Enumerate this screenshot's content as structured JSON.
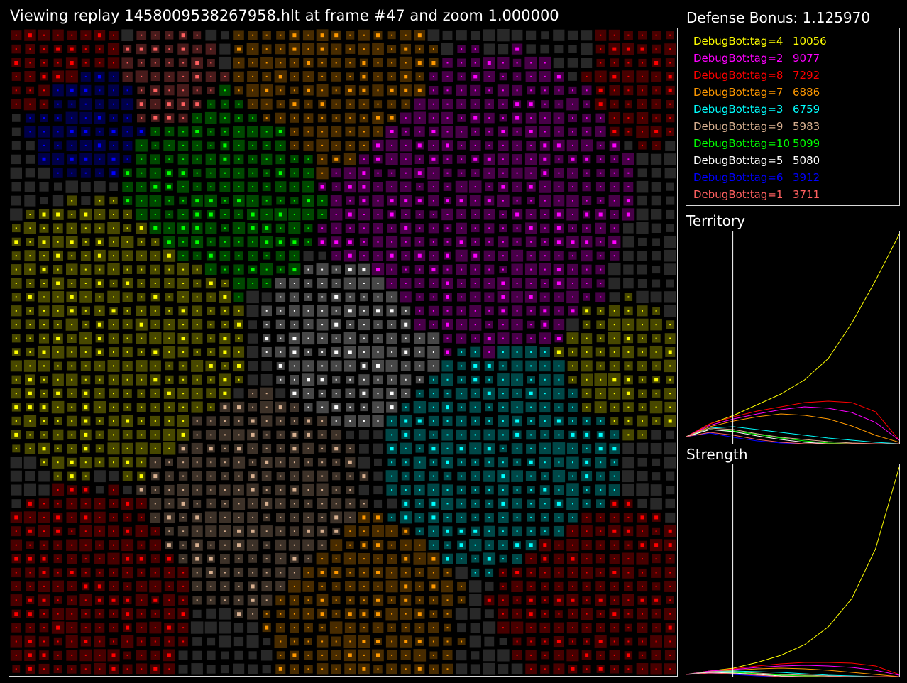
{
  "header": {
    "title": "Viewing replay 1458009538267958.hlt at frame #47 and zoom 1.000000",
    "defense_bonus": "Defense Bonus: 1.125970"
  },
  "leaderboard": [
    {
      "name": "DebugBot:tag=4",
      "score": "10056",
      "color": "#ffff00"
    },
    {
      "name": "DebugBot:tag=2",
      "score": "9077",
      "color": "#ff00ff"
    },
    {
      "name": "DebugBot:tag=8",
      "score": "7292",
      "color": "#ff0000"
    },
    {
      "name": "DebugBot:tag=7",
      "score": "6886",
      "color": "#ff9900"
    },
    {
      "name": "DebugBot:tag=3",
      "score": "6759",
      "color": "#00ffff"
    },
    {
      "name": "DebugBot:tag=9",
      "score": "5983",
      "color": "#d8b090"
    },
    {
      "name": "DebugBot:tag=10",
      "score": "5099",
      "color": "#00ff00"
    },
    {
      "name": "DebugBot:tag=5",
      "score": "5080",
      "color": "#ffffff"
    },
    {
      "name": "DebugBot:tag=6",
      "score": "3912",
      "color": "#0000ff"
    },
    {
      "name": "DebugBot:tag=1",
      "score": "3711",
      "color": "#ff6060"
    }
  ],
  "panels": {
    "territory_label": "Territory",
    "strength_label": "Strength"
  },
  "board": {
    "grid_size": [
      48,
      47
    ],
    "neutral_color": "#282828",
    "regions": [
      {
        "player": "DebugBot:tag=4",
        "color": "#ffff00",
        "center": [
          6,
          22
        ],
        "weight": 1.15
      },
      {
        "player": "DebugBot:tag=4",
        "color": "#ffff00",
        "center": [
          44,
          24
        ],
        "weight": 0.55
      },
      {
        "player": "DebugBot:tag=2",
        "color": "#ff00ff",
        "center": [
          33,
          12
        ],
        "weight": 1.25
      },
      {
        "player": "DebugBot:tag=8",
        "color": "#ff0000",
        "center": [
          5,
          41
        ],
        "weight": 0.9
      },
      {
        "player": "DebugBot:tag=8",
        "color": "#ff0000",
        "center": [
          42,
          41
        ],
        "weight": 0.85
      },
      {
        "player": "DebugBot:tag=8",
        "color": "#ff0000",
        "center": [
          2,
          1
        ],
        "weight": 0.6
      },
      {
        "player": "DebugBot:tag=8",
        "color": "#ff0000",
        "center": [
          46,
          3
        ],
        "weight": 0.55
      },
      {
        "player": "DebugBot:tag=7",
        "color": "#ff9900",
        "center": [
          23,
          3
        ],
        "weight": 0.85
      },
      {
        "player": "DebugBot:tag=7",
        "color": "#ff9900",
        "center": [
          25,
          42
        ],
        "weight": 0.8
      },
      {
        "player": "DebugBot:tag=3",
        "color": "#00ffff",
        "center": [
          35,
          31
        ],
        "weight": 0.95
      },
      {
        "player": "DebugBot:tag=9",
        "color": "#d8b090",
        "center": [
          17,
          34
        ],
        "weight": 0.9
      },
      {
        "player": "DebugBot:tag=10",
        "color": "#00ff00",
        "center": [
          15,
          11
        ],
        "weight": 0.85
      },
      {
        "player": "DebugBot:tag=5",
        "color": "#ffffff",
        "center": [
          24,
          22
        ],
        "weight": 0.7
      },
      {
        "player": "DebugBot:tag=6",
        "color": "#0000ff",
        "center": [
          5,
          6
        ],
        "weight": 0.5
      },
      {
        "player": "DebugBot:tag=1",
        "color": "#ff6060",
        "center": [
          11,
          3
        ],
        "weight": 0.45
      }
    ]
  },
  "chart_data": [
    {
      "type": "line",
      "title": "Territory",
      "current_frame": 47,
      "frames": 215,
      "series": [
        {
          "name": "DebugBot:tag=4",
          "color": "#ffff00",
          "values": [
            10,
            28,
            40,
            55,
            70,
            90,
            120,
            170,
            230,
            295
          ]
        },
        {
          "name": "DebugBot:tag=8",
          "color": "#ff0000",
          "values": [
            10,
            28,
            38,
            46,
            52,
            58,
            60,
            58,
            45,
            5
          ]
        },
        {
          "name": "DebugBot:tag=2",
          "color": "#ff00ff",
          "values": [
            10,
            26,
            35,
            42,
            48,
            52,
            50,
            44,
            30,
            5
          ]
        },
        {
          "name": "DebugBot:tag=7",
          "color": "#ff9900",
          "values": [
            10,
            24,
            32,
            38,
            42,
            40,
            35,
            25,
            12,
            2
          ]
        },
        {
          "name": "DebugBot:tag=3",
          "color": "#00ffff",
          "values": [
            10,
            22,
            24,
            20,
            16,
            12,
            8,
            5,
            2,
            0
          ]
        },
        {
          "name": "DebugBot:tag=9",
          "color": "#d8b090",
          "values": [
            10,
            22,
            20,
            14,
            9,
            6,
            3,
            1,
            0,
            0
          ]
        },
        {
          "name": "DebugBot:tag=10",
          "color": "#00ff00",
          "values": [
            10,
            20,
            18,
            13,
            8,
            4,
            1,
            0,
            0,
            0
          ]
        },
        {
          "name": "DebugBot:tag=5",
          "color": "#ffffff",
          "values": [
            10,
            20,
            17,
            11,
            6,
            2,
            0,
            0,
            0,
            0
          ]
        },
        {
          "name": "DebugBot:tag=6",
          "color": "#0000ff",
          "values": [
            10,
            15,
            9,
            4,
            1,
            0,
            0,
            0,
            0,
            0
          ]
        },
        {
          "name": "DebugBot:tag=1",
          "color": "#ff6060",
          "values": [
            10,
            16,
            12,
            6,
            2,
            0,
            0,
            0,
            0,
            0
          ]
        }
      ]
    },
    {
      "type": "line",
      "title": "Strength",
      "current_frame": 47,
      "frames": 215,
      "series": [
        {
          "name": "DebugBot:tag=4",
          "color": "#ffff00",
          "values": [
            3,
            8,
            12,
            20,
            30,
            45,
            70,
            110,
            180,
            295
          ]
        },
        {
          "name": "DebugBot:tag=8",
          "color": "#ff0000",
          "values": [
            3,
            8,
            11,
            15,
            18,
            20,
            20,
            19,
            15,
            3
          ]
        },
        {
          "name": "DebugBot:tag=2",
          "color": "#ff00ff",
          "values": [
            3,
            8,
            10,
            13,
            15,
            16,
            15,
            13,
            9,
            2
          ]
        },
        {
          "name": "DebugBot:tag=7",
          "color": "#ff9900",
          "values": [
            3,
            7,
            9,
            11,
            12,
            11,
            9,
            6,
            3,
            0
          ]
        },
        {
          "name": "DebugBot:tag=3",
          "color": "#00ffff",
          "values": [
            3,
            7,
            8,
            7,
            6,
            4,
            2,
            1,
            0,
            0
          ]
        },
        {
          "name": "DebugBot:tag=9",
          "color": "#d8b090",
          "values": [
            3,
            7,
            7,
            5,
            3,
            2,
            1,
            0,
            0,
            0
          ]
        },
        {
          "name": "DebugBot:tag=10",
          "color": "#00ff00",
          "values": [
            3,
            6,
            6,
            4,
            2,
            1,
            0,
            0,
            0,
            0
          ]
        },
        {
          "name": "DebugBot:tag=5",
          "color": "#ffffff",
          "values": [
            3,
            6,
            5,
            3,
            1,
            0,
            0,
            0,
            0,
            0
          ]
        },
        {
          "name": "DebugBot:tag=6",
          "color": "#0000ff",
          "values": [
            3,
            5,
            3,
            1,
            0,
            0,
            0,
            0,
            0,
            0
          ]
        },
        {
          "name": "DebugBot:tag=1",
          "color": "#ff6060",
          "values": [
            3,
            5,
            4,
            2,
            0,
            0,
            0,
            0,
            0,
            0
          ]
        }
      ]
    }
  ]
}
